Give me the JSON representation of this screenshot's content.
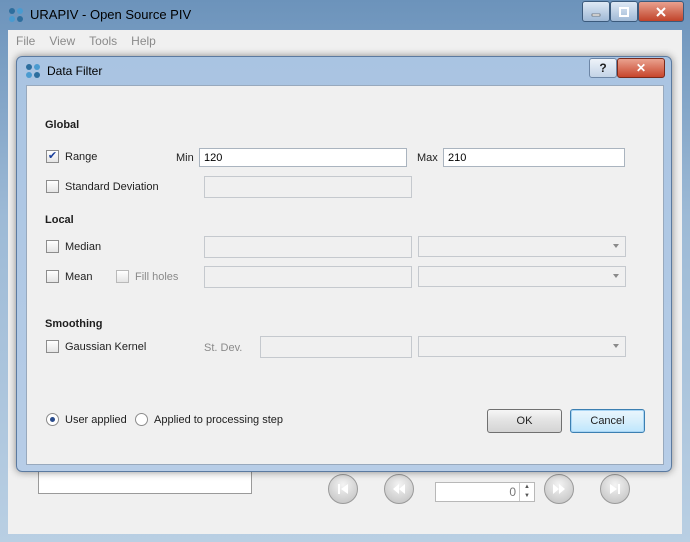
{
  "app": {
    "title": "URAPIV - Open Source PIV",
    "menu": [
      "File",
      "View",
      "Tools",
      "Help"
    ],
    "spinner_value": "0"
  },
  "dialog": {
    "title": "Data Filter",
    "help_label": "?",
    "close_label": "✕",
    "global": {
      "heading": "Global",
      "range": {
        "label": "Range",
        "checked": true,
        "min_label": "Min",
        "min_value": "120",
        "max_label": "Max",
        "max_value": "210"
      },
      "std": {
        "label": "Standard Deviation",
        "checked": false
      }
    },
    "local": {
      "heading": "Local",
      "median": {
        "label": "Median",
        "checked": false
      },
      "mean": {
        "label": "Mean",
        "checked": false
      },
      "fill_holes": {
        "label": "Fill holes",
        "checked": false
      }
    },
    "smoothing": {
      "heading": "Smoothing",
      "gaussian": {
        "label": "Gaussian Kernel",
        "checked": false
      },
      "st_dev_label": "St. Dev."
    },
    "apply_mode": {
      "user_applied": "User applied",
      "processing_step": "Applied to processing step",
      "selected": "user_applied"
    },
    "buttons": {
      "ok": "OK",
      "cancel": "Cancel"
    }
  }
}
